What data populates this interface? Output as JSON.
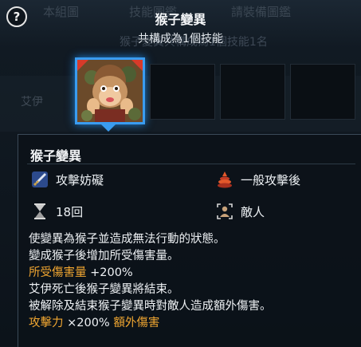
{
  "header": {
    "title": "猴子變異",
    "subtitle": "共構成為1個技能",
    "help_label": "?"
  },
  "background": {
    "tabs": [
      "技能圖鑑",
      "請裝備圖鑑"
    ],
    "partial_tab": "本組圖",
    "subtitle_ghost": "猴子變異共構成為1個技能1名",
    "row_name": "艾伊"
  },
  "skill_slots": [
    {
      "icon": "monkey-portrait-icon",
      "selected": true
    },
    {
      "icon": "empty-slot",
      "selected": false
    },
    {
      "icon": "empty-slot",
      "selected": false
    },
    {
      "icon": "empty-slot",
      "selected": false
    }
  ],
  "tooltip": {
    "name": "猴子變異",
    "stats": {
      "type": {
        "icon": "sword-icon",
        "text": "攻擊妨礙"
      },
      "timing": {
        "icon": "cone-stack-icon",
        "text": "一般攻擊後"
      },
      "duration": {
        "icon": "hourglass-icon",
        "text": "18回"
      },
      "target": {
        "icon": "person-target-icon",
        "text": "敵人"
      }
    },
    "description": [
      {
        "segments": [
          {
            "text": "使變異為猴子並造成無法行動的狀態。",
            "color": "white"
          }
        ]
      },
      {
        "segments": [
          {
            "text": "變成猴子後增加所受傷害量。",
            "color": "white"
          }
        ]
      },
      {
        "segments": [
          {
            "text": "所受傷害量",
            "color": "orange"
          },
          {
            "text": " +200%",
            "color": "white"
          }
        ]
      },
      {
        "segments": [
          {
            "text": "艾伊死亡後猴子變異將結束。",
            "color": "white"
          }
        ]
      },
      {
        "segments": [
          {
            "text": "被解除及結束猴子變異時對敵人造成額外傷害。",
            "color": "white"
          }
        ]
      },
      {
        "segments": [
          {
            "text": "攻擊力",
            "color": "orange"
          },
          {
            "text": " ×200% ",
            "color": "white"
          },
          {
            "text": "額外傷害",
            "color": "orange"
          }
        ]
      }
    ]
  },
  "colors": {
    "accent_blue": "#3a9cf0",
    "highlight_orange": "#f0a631"
  }
}
